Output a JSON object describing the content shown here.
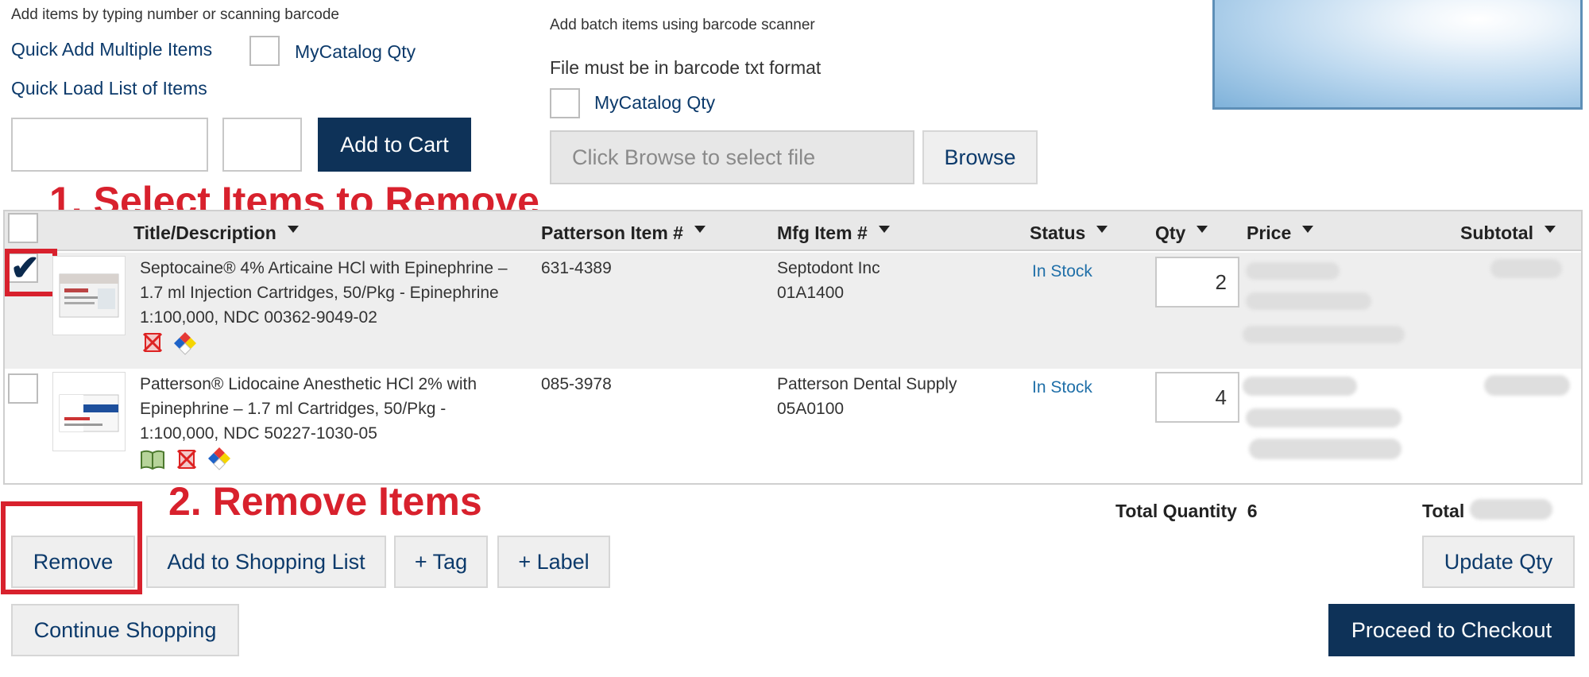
{
  "quick_add": {
    "hint": "Add items by typing number or scanning barcode",
    "multiple_link": "Quick Add Multiple Items",
    "mycatalog_label": "MyCatalog Qty",
    "load_list_link": "Quick Load List of Items",
    "item_value": "",
    "qty_value": "",
    "add_button": "Add to Cart"
  },
  "batch": {
    "hint": "Add batch items using barcode scanner",
    "format_note": "File must be in barcode txt format",
    "mycatalog_label": "MyCatalog Qty",
    "file_placeholder": "Click Browse to select file",
    "browse_button": "Browse"
  },
  "annotations": {
    "step1": "1. Select Items to Remove",
    "step2": "2. Remove Items"
  },
  "table": {
    "headers": {
      "title": "Title/Description",
      "patterson": "Patterson Item #",
      "mfg": "Mfg Item #",
      "status": "Status",
      "qty": "Qty",
      "price": "Price",
      "subtotal": "Subtotal"
    },
    "rows": [
      {
        "checked": true,
        "check_mark": "✔",
        "title_lines": [
          "Septocaine® 4% Articaine HCl with Epinephrine –",
          "1.7 ml Injection Cartridges, 50/Pkg - Epinephrine",
          "1:100,000, NDC 00362-9049-02"
        ],
        "patterson_item": "631-4389",
        "mfg_name": "Septodont Inc",
        "mfg_item": "01A1400",
        "status": "In Stock",
        "qty": "2",
        "icons": [
          "no-latex-icon",
          "hazard-diamond-icon"
        ]
      },
      {
        "checked": false,
        "title_lines": [
          "Patterson® Lidocaine Anesthetic HCl 2% with",
          "Epinephrine – 1.7 ml Cartridges, 50/Pkg -",
          "1:100,000, NDC 50227-1030-05"
        ],
        "patterson_item": "085-3978",
        "mfg_name": "Patterson Dental Supply",
        "mfg_item": "05A0100",
        "status": "In Stock",
        "qty": "4",
        "icons": [
          "book-icon",
          "no-latex-icon",
          "hazard-diamond-icon"
        ]
      }
    ]
  },
  "totals": {
    "quantity_label": "Total Quantity",
    "quantity_value": "6",
    "total_label": "Total"
  },
  "actions": {
    "remove": "Remove",
    "add_to_list": "Add to Shopping List",
    "tag": "+ Tag",
    "label": "+ Label",
    "update_qty": "Update Qty",
    "continue": "Continue Shopping",
    "checkout": "Proceed to Checkout"
  },
  "colors": {
    "navy": "#0e3258",
    "annotation_red": "#d8212d",
    "status_blue": "#1f6fa8"
  }
}
